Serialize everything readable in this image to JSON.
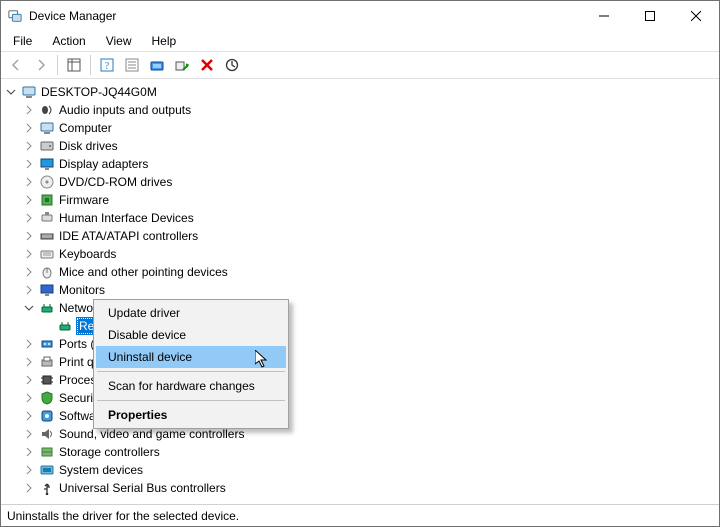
{
  "window": {
    "title": "Device Manager"
  },
  "menu": {
    "file": "File",
    "action": "Action",
    "view": "View",
    "help": "Help"
  },
  "tree": {
    "root_label": "DESKTOP-JQ44G0M",
    "categories": [
      "Audio inputs and outputs",
      "Computer",
      "Disk drives",
      "Display adapters",
      "DVD/CD-ROM drives",
      "Firmware",
      "Human Interface Devices",
      "IDE ATA/ATAPI controllers",
      "Keyboards",
      "Mice and other pointing devices",
      "Monitors",
      "Network adapters",
      "Ports (COM & LPT)",
      "Print queues",
      "Processors",
      "Security devices",
      "Software devices",
      "Sound, video and game controllers",
      "Storage controllers",
      "System devices",
      "Universal Serial Bus controllers"
    ],
    "network_device": "Realtek PCIe GBE Family Controller"
  },
  "context_menu": {
    "update": "Update driver",
    "disable": "Disable device",
    "uninstall": "Uninstall device",
    "scan": "Scan for hardware changes",
    "properties": "Properties"
  },
  "status": {
    "text": "Uninstalls the driver for the selected device."
  }
}
